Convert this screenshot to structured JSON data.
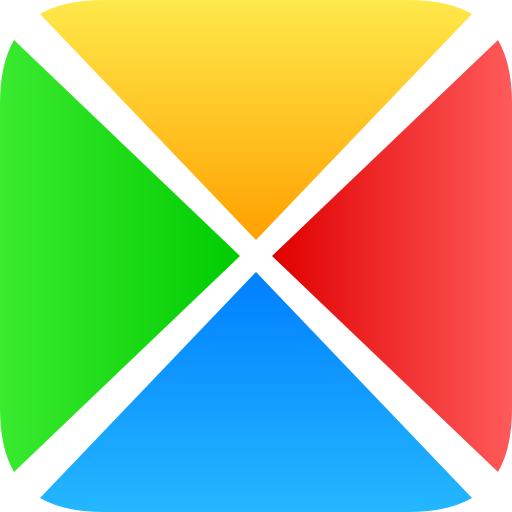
{
  "icon": {
    "quadrants": [
      {
        "name": "top",
        "color_start": "#ffe84a",
        "color_end": "#ffa100"
      },
      {
        "name": "right",
        "color_start": "#e00000",
        "color_end": "#ff5a5a"
      },
      {
        "name": "bottom",
        "color_start": "#007fff",
        "color_end": "#24b7ff"
      },
      {
        "name": "left",
        "color_start": "#3bea2f",
        "color_end": "#00cc00"
      }
    ],
    "background": "#ffffff"
  }
}
